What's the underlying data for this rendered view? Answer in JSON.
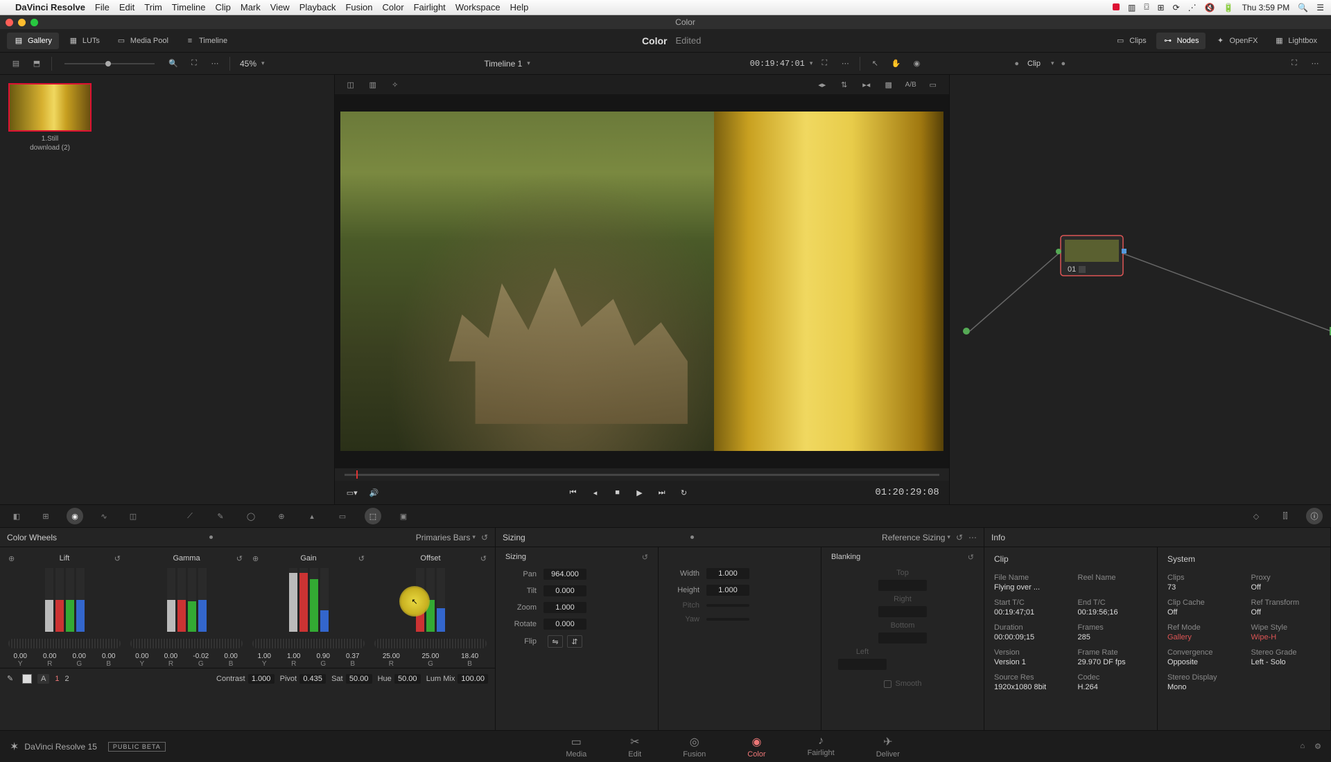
{
  "menubar": {
    "appname": "DaVinci Resolve",
    "items": [
      "File",
      "Edit",
      "Trim",
      "Timeline",
      "Clip",
      "Mark",
      "View",
      "Playback",
      "Fusion",
      "Color",
      "Fairlight",
      "Workspace",
      "Help"
    ],
    "clock": "Thu 3:59 PM"
  },
  "window_title": "Color",
  "toolbarA": {
    "gallery": "Gallery",
    "luts": "LUTs",
    "mediapool": "Media Pool",
    "timeline": "Timeline",
    "page_title": "Color",
    "page_sub": "Edited",
    "clips": "Clips",
    "nodes": "Nodes",
    "openfx": "OpenFX",
    "lightbox": "Lightbox"
  },
  "toolbarB": {
    "zoom": "45%",
    "timeline_name": "Timeline 1",
    "tc_left": "00:19:47:01",
    "clip_label": "Clip"
  },
  "gallery": {
    "still_caption1": "1.Still",
    "still_caption2": "download (2)"
  },
  "transport": {
    "tc": "01:20:29:08"
  },
  "node": {
    "label": "01"
  },
  "palette_header": {
    "wheels_title": "Color Wheels",
    "wheels_mode": "Primaries Bars",
    "sizing_title": "Sizing",
    "sizing_mode": "Reference Sizing",
    "info_title": "Info"
  },
  "wheels": {
    "groups": [
      "Lift",
      "Gamma",
      "Gain",
      "Offset"
    ],
    "vals": {
      "lift": {
        "Y": "0.00",
        "R": "0.00",
        "G": "0.00",
        "B": "0.00"
      },
      "gamma": {
        "Y": "0.00",
        "R": "0.00",
        "G": "-0.02",
        "B": "0.00"
      },
      "gain": {
        "Y": "1.00",
        "R": "1.00",
        "G": "0.90",
        "B": "0.37"
      },
      "offset": {
        "R": "25.00",
        "G": "25.00",
        "B": "18.40"
      }
    },
    "global": {
      "contrast_l": "Contrast",
      "contrast": "1.000",
      "pivot_l": "Pivot",
      "pivot": "0.435",
      "sat_l": "Sat",
      "sat": "50.00",
      "hue_l": "Hue",
      "hue": "50.00",
      "lummix_l": "Lum Mix",
      "lummix": "100.00",
      "a": "A",
      "one": "1",
      "two": "2"
    }
  },
  "sizing": {
    "sub": "Sizing",
    "pan_l": "Pan",
    "pan": "964.000",
    "tilt_l": "Tilt",
    "tilt": "0.000",
    "zoom_l": "Zoom",
    "zoom": "1.000",
    "rotate_l": "Rotate",
    "rotate": "0.000",
    "flip_l": "Flip",
    "width_l": "Width",
    "width": "1.000",
    "height_l": "Height",
    "height": "1.000",
    "pitch_l": "Pitch",
    "yaw_l": "Yaw",
    "blanking": "Blanking",
    "top": "Top",
    "right": "Right",
    "bottom": "Bottom",
    "left": "Left",
    "smooth": "Smooth"
  },
  "info": {
    "clip_h": "Clip",
    "system_h": "System",
    "filename_l": "File Name",
    "filename": "Flying over  ...",
    "reelname_l": "Reel Name",
    "starttc_l": "Start T/C",
    "starttc": "00:19:47;01",
    "endtc_l": "End T/C",
    "endtc": "00:19:56;16",
    "duration_l": "Duration",
    "duration": "00:00:09;15",
    "frames_l": "Frames",
    "frames": "285",
    "version_l": "Version",
    "version": "Version 1",
    "framerate_l": "Frame Rate",
    "framerate": "29.970 DF fps",
    "sourceres_l": "Source Res",
    "sourceres": "1920x1080 8bit",
    "codec_l": "Codec",
    "codec": "H.264",
    "clips_l": "Clips",
    "clips": "73",
    "proxy_l": "Proxy",
    "proxy": "Off",
    "clipcache_l": "Clip Cache",
    "clipcache": "Off",
    "reftransform_l": "Ref Transform",
    "reftransform": "Off",
    "refmode_l": "Ref Mode",
    "refmode": "Gallery",
    "wipestyle_l": "Wipe Style",
    "wipestyle": "Wipe-H",
    "convergence_l": "Convergence",
    "convergence": "Opposite",
    "stereograde_l": "Stereo Grade",
    "stereograde": "Left - Solo",
    "stereodisplay_l": "Stereo Display",
    "stereodisplay": "Mono"
  },
  "pages": {
    "brand": "DaVinci Resolve 15",
    "beta": "PUBLIC BETA",
    "tabs": [
      "Media",
      "Edit",
      "Fusion",
      "Color",
      "Fairlight",
      "Deliver"
    ]
  }
}
